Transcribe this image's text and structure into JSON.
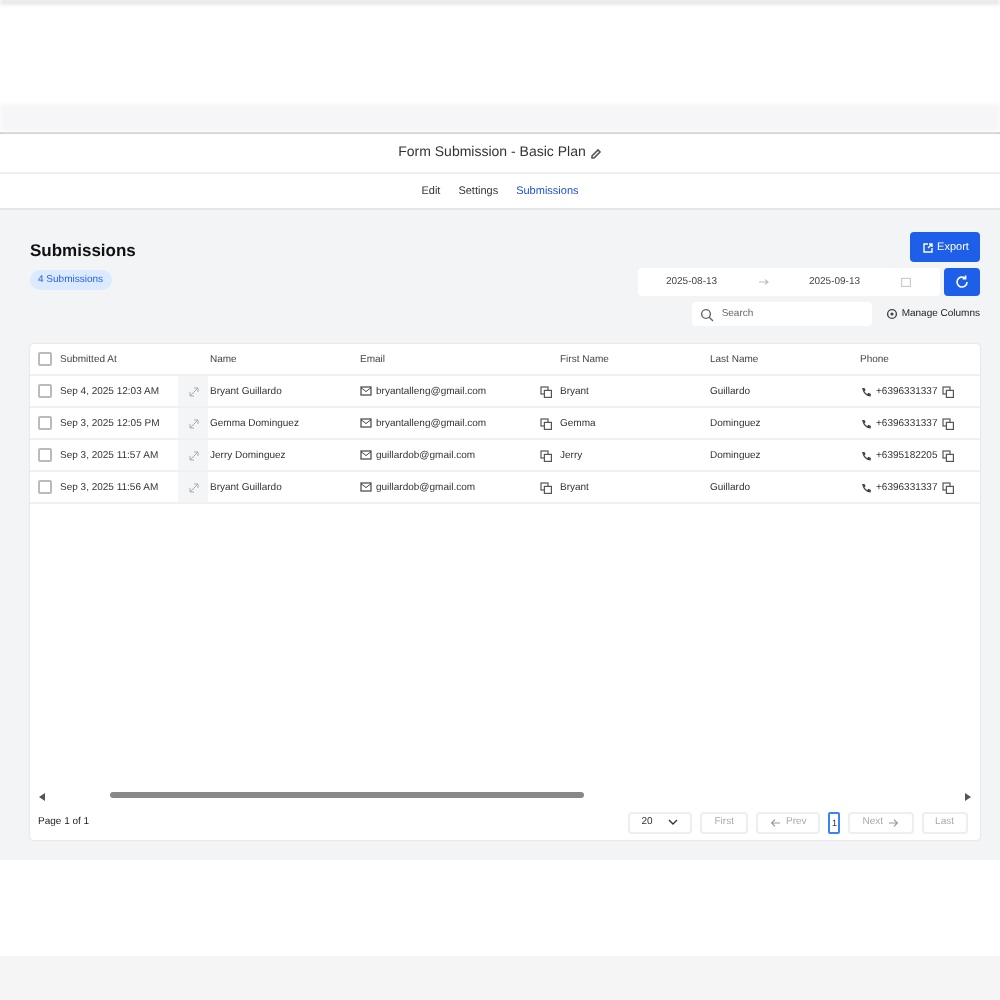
{
  "header": {
    "title": "Form Submission - Basic Plan"
  },
  "tabs": [
    {
      "label": "Edit",
      "selected": false
    },
    {
      "label": "Settings",
      "selected": false
    },
    {
      "label": "Submissions",
      "selected": true
    }
  ],
  "page": {
    "title": "Submissions",
    "count_badge": "4 Submissions",
    "export_button": "Export",
    "date_range": {
      "start": "2025-08-13",
      "end": "2025-09-13"
    },
    "search": {
      "placeholder": "Search"
    },
    "manage_columns": "Manage Columns"
  },
  "table": {
    "select_all_checked": false,
    "columns": [
      "Submitted At",
      "Name",
      "Email",
      "First Name",
      "Last Name",
      "Phone"
    ],
    "rows": [
      {
        "checked": false,
        "submitted_at": "Sep 4, 2025 12:03 AM",
        "name": "Bryant Guillardo",
        "email": "bryantalleng@gmail.com",
        "first_name": "Bryant",
        "last_name": "Guillardo",
        "phone": "+6396331337"
      },
      {
        "checked": false,
        "submitted_at": "Sep 3, 2025 12:05 PM",
        "name": "Gemma Dominguez",
        "email": "bryantalleng@gmail.com",
        "first_name": "Gemma",
        "last_name": "Dominguez",
        "phone": "+6396331337"
      },
      {
        "checked": false,
        "submitted_at": "Sep 3, 2025 11:57 AM",
        "name": "Jerry Dominguez",
        "email": "guillardob@gmail.com",
        "first_name": "Jerry",
        "last_name": "Dominguez",
        "phone": "+6395182205"
      },
      {
        "checked": false,
        "submitted_at": "Sep 3, 2025 11:56 AM",
        "name": "Bryant Guillardo",
        "email": "guillardob@gmail.com",
        "first_name": "Bryant",
        "last_name": "Guillardo",
        "phone": "+6396331337"
      }
    ]
  },
  "pagination": {
    "page_info": "Page 1 of 1",
    "page_size": "20",
    "current_page": "1",
    "buttons": [
      {
        "kind": "first",
        "label": "First",
        "disabled": true
      },
      {
        "kind": "prev",
        "label": "Prev",
        "disabled": true
      },
      {
        "kind": "next",
        "label": "Next",
        "disabled": true
      },
      {
        "kind": "last",
        "label": "Last",
        "disabled": true
      }
    ]
  }
}
